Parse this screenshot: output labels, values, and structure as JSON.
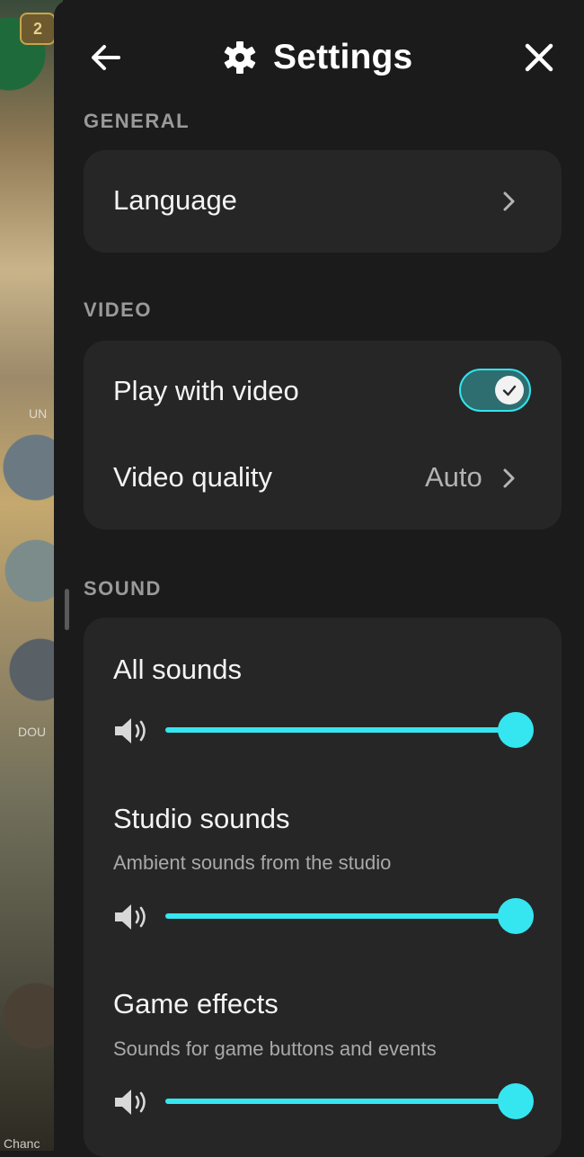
{
  "background": {
    "level_badge": "2",
    "fragments": [
      "UN",
      "DOU",
      "Chanc"
    ]
  },
  "header": {
    "title": "Settings",
    "back_icon": "arrow-left-icon",
    "settings_icon": "gear-icon",
    "close_icon": "close-icon"
  },
  "general": {
    "section_label": "GENERAL",
    "language_label": "Language"
  },
  "video": {
    "section_label": "VIDEO",
    "play_with_video_label": "Play with video",
    "play_with_video_enabled": true,
    "video_quality_label": "Video quality",
    "video_quality_value": "Auto"
  },
  "sound": {
    "section_label": "SOUND",
    "all_sounds": {
      "label": "All sounds",
      "level": 1.0
    },
    "studio_sounds": {
      "label": "Studio sounds",
      "description": "Ambient sounds from the studio",
      "level": 1.0
    },
    "game_effects": {
      "label": "Game effects",
      "description": "Sounds for game buttons and events",
      "level": 1.0
    }
  },
  "colors": {
    "accent": "#35e6f0",
    "panel_bg": "#1b1b1b",
    "card_bg": "#262626",
    "section_label": "#9a9a9a"
  }
}
